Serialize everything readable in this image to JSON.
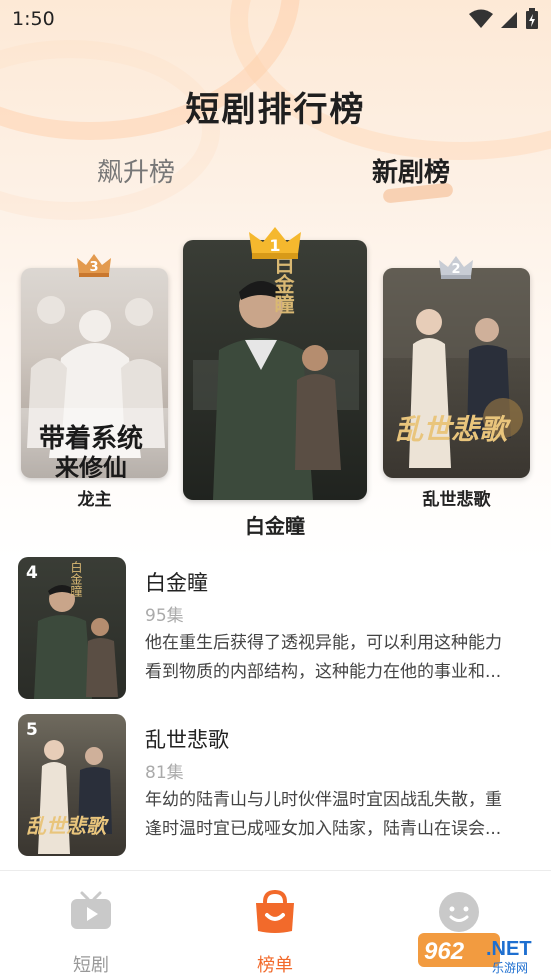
{
  "status_bar": {
    "time": "1:50"
  },
  "page_title": "短剧排行榜",
  "tabs": [
    {
      "label": "飙升榜",
      "active": false
    },
    {
      "label": "新剧榜",
      "active": true
    }
  ],
  "podium": [
    {
      "rank": "1",
      "name": "白金瞳",
      "poster_text": "白金瞳",
      "crown": "gold-crown-icon"
    },
    {
      "rank": "2",
      "name": "乱世悲歌",
      "poster_text": "乱世悲歌",
      "crown": "silver-crown-icon"
    },
    {
      "rank": "3",
      "name": "龙主",
      "poster_text_line1": "带着系统",
      "poster_text_line2": "来修仙",
      "crown": "bronze-crown-icon"
    }
  ],
  "list": [
    {
      "rank": "4",
      "title": "白金瞳",
      "episodes": "95集",
      "poster_text": "白金瞳",
      "desc_line1": "他在重生后获得了透视异能，可以利用这种能力",
      "desc_line2": "看到物质的内部结构，这种能力在他的事业和..."
    },
    {
      "rank": "5",
      "title": "乱世悲歌",
      "episodes": "81集",
      "poster_text": "乱世悲歌",
      "desc_line1": "年幼的陆青山与儿时伙伴温时宜因战乱失散，重",
      "desc_line2": "逢时温时宜已成哑女加入陆家，陆青山在误会..."
    }
  ],
  "bottom_nav": [
    {
      "label": "短剧",
      "icon": "tv-icon",
      "active": false
    },
    {
      "label": "榜单",
      "icon": "ranking-bag-icon",
      "active": true
    },
    {
      "label": "",
      "icon": "smiley-profile-icon",
      "active": false
    }
  ],
  "watermark": {
    "brand": "962.NET",
    "sub": "乐游网"
  },
  "colors": {
    "accent": "#f26a2b",
    "gold": "#f5b82e",
    "silver": "#c8ccd4",
    "bronze": "#e39a4e"
  }
}
